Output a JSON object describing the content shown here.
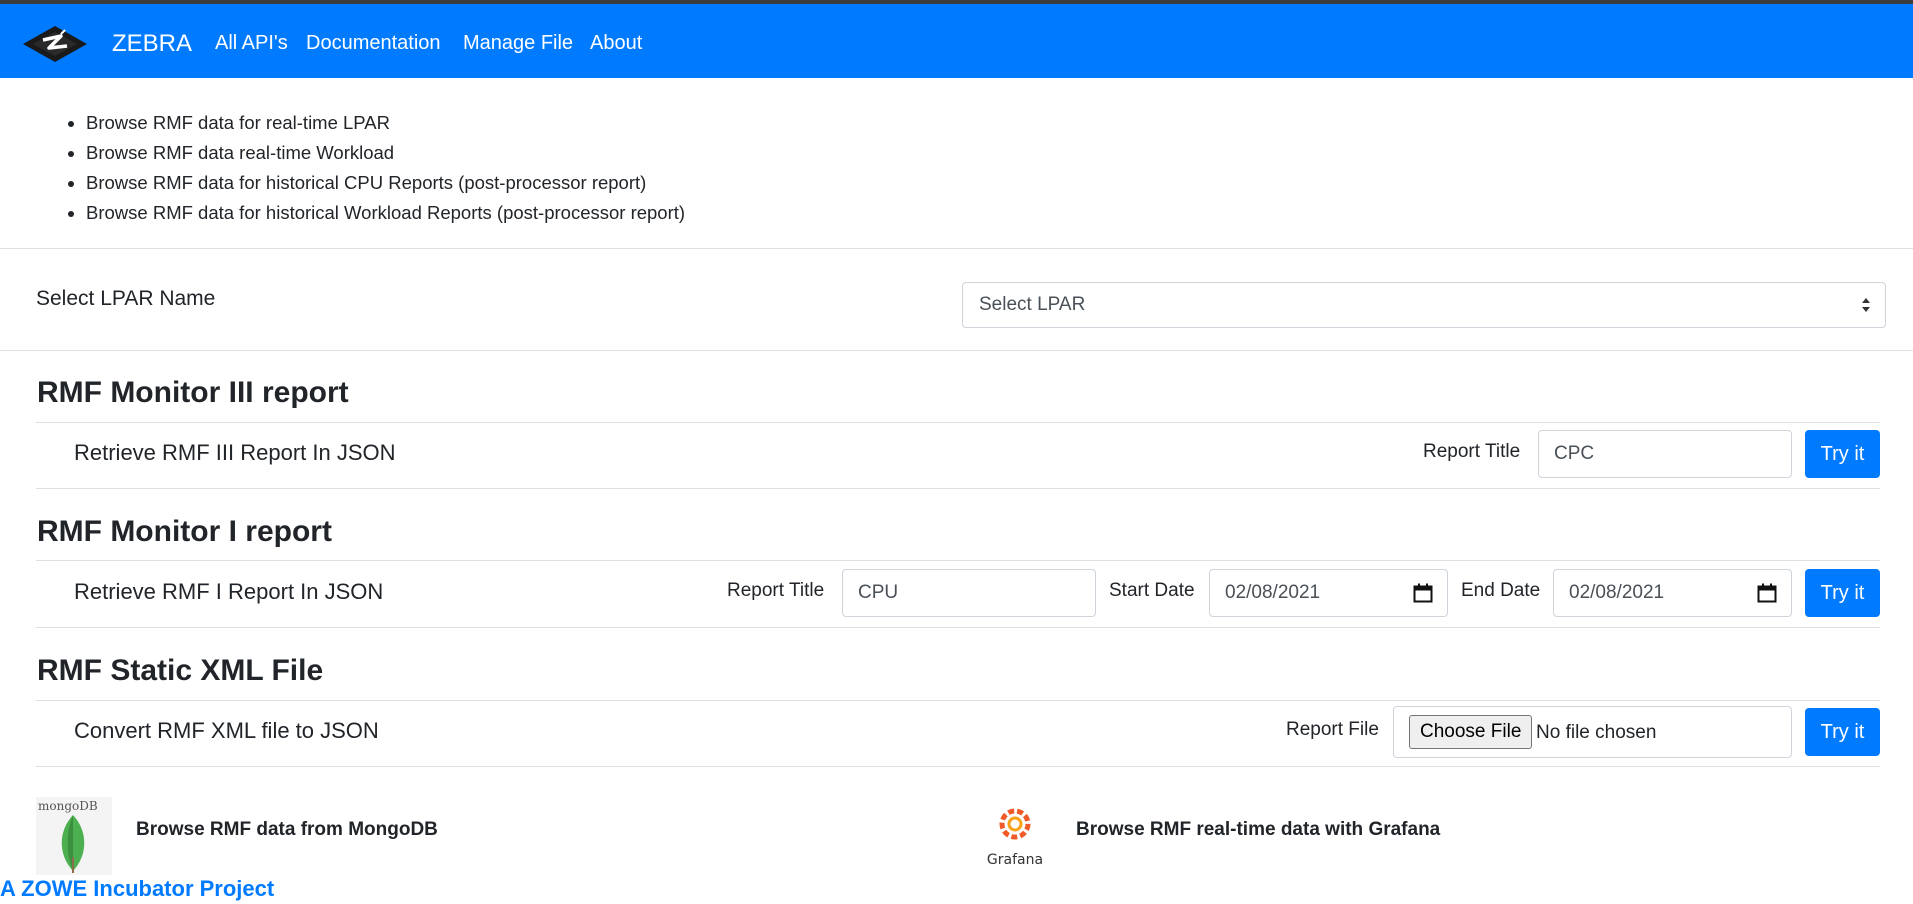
{
  "navbar": {
    "brand": "ZEBRA",
    "links": [
      "All API's",
      "Documentation",
      "Manage File",
      "About"
    ]
  },
  "intro_list": [
    "Browse RMF data for real-time LPAR",
    "Browse RMF data real-time Workload",
    "Browse RMF data for historical CPU Reports (post-processor report)",
    "Browse RMF data for historical Workload Reports (post-processor report)"
  ],
  "lpar": {
    "label": "Select LPAR Name",
    "selected": "Select LPAR"
  },
  "monitor3": {
    "title": "RMF Monitor III report",
    "row_label": "Retrieve RMF III Report In JSON",
    "field_label": "Report Title",
    "field_value": "CPC",
    "button": "Try it"
  },
  "monitor1": {
    "title": "RMF Monitor I report",
    "row_label": "Retrieve RMF I Report In JSON",
    "report_title_label": "Report Title",
    "report_title_value": "CPU",
    "start_date_label": "Start Date",
    "start_date_value": "02/08/2021",
    "end_date_label": "End Date",
    "end_date_value": "02/08/2021",
    "button": "Try it"
  },
  "static_xml": {
    "title": "RMF Static XML File",
    "row_label": "Convert RMF XML file to JSON",
    "field_label": "Report File",
    "choose_file": "Choose File",
    "no_file": "No file chosen",
    "button": "Try it"
  },
  "integrations": {
    "mongo_logo_text": "mongoDB",
    "mongo_label": "Browse RMF data from MongoDB",
    "grafana_logo_text": "Grafana",
    "grafana_label": "Browse RMF real-time data with Grafana"
  },
  "footer": {
    "zowe_link": "A ZOWE Incubator Project"
  },
  "colors": {
    "primary": "#007bff",
    "text": "#212529",
    "border": "#ced4da"
  }
}
